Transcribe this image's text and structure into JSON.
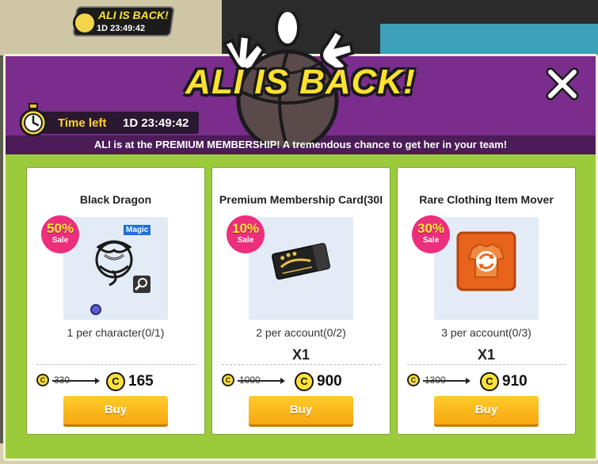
{
  "background": {
    "badge_title": "ALI IS BACK!",
    "badge_time": "1D 23:49:42"
  },
  "popup": {
    "title": "ALI IS BACK!",
    "close_label": "✕",
    "timer_label": "Time left",
    "timer_value": "1D 23:49:42",
    "subtitle": "ALI is at the PREMIUM MEMBERSHIP! A tremendous chance to get her in your team!"
  },
  "cards": [
    {
      "name": "Black Dragon",
      "sale_pct": "50%",
      "sale_word": "Sale",
      "tag": "Magic",
      "qty": "",
      "limit": "1 per character(0/1)",
      "coin_symbol": "C",
      "old_price": "330",
      "new_price": "165",
      "buy_label": "Buy",
      "icon": "dragon-emblem-icon"
    },
    {
      "name": "Premium Membership Card(30I",
      "sale_pct": "10%",
      "sale_word": "Sale",
      "qty": "X1",
      "limit": "2 per account(0/2)",
      "coin_symbol": "C",
      "old_price": "1000",
      "new_price": "900",
      "buy_label": "Buy",
      "icon": "premium-ticket-icon"
    },
    {
      "name": "Rare Clothing Item Mover",
      "sale_pct": "30%",
      "sale_word": "Sale",
      "qty": "X1",
      "limit": "3 per account(0/3)",
      "coin_symbol": "C",
      "old_price": "1300",
      "new_price": "910",
      "buy_label": "Buy",
      "icon": "clothing-swap-icon"
    }
  ],
  "colors": {
    "header": "#7a2d8c",
    "frame": "#9bcb3b",
    "title": "#ffe22e",
    "sale_badge": "#ec2f7c",
    "buy_button": "#f6a812"
  }
}
